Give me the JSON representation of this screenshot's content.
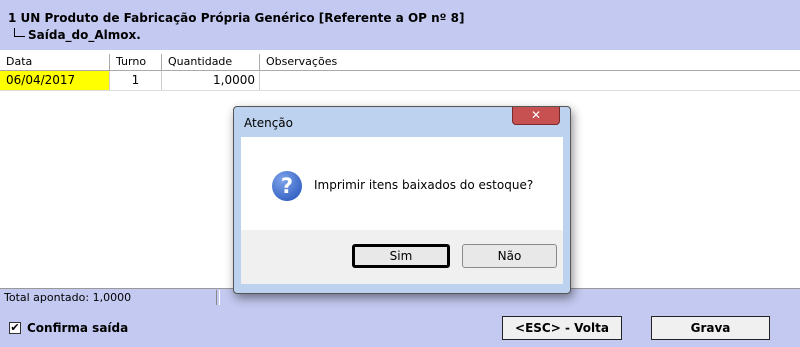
{
  "header": {
    "title": "1 UN Produto de Fabricação Própria Genérico [Referente a OP nº 8]",
    "subtitle": "Saída_do_Almox."
  },
  "table": {
    "columns": [
      "Data",
      "Turno",
      "Quantidade",
      "Observações"
    ],
    "rows": [
      {
        "data": "06/04/2017",
        "turno": "1",
        "quantidade": "1,0000",
        "observacoes": ""
      }
    ],
    "highlight_color": "#ffff00"
  },
  "status": {
    "total_text": "Total apontado: 1,0000"
  },
  "footer": {
    "checkbox_label": "Confirma saída",
    "checkbox_checked": true,
    "check_mark": "✔",
    "back_button": "<ESC> - Volta",
    "save_button": "Grava"
  },
  "dialog": {
    "title": "Atenção",
    "close_glyph": "✕",
    "icon": "question-icon",
    "icon_glyph": "?",
    "message": "Imprimir itens baixados do estoque?",
    "yes_button": "Sim",
    "no_button": "Não"
  },
  "colors": {
    "background": "#c3c9f0",
    "dialog_frame": "#bcd2ee",
    "close_button": "#c75050"
  }
}
